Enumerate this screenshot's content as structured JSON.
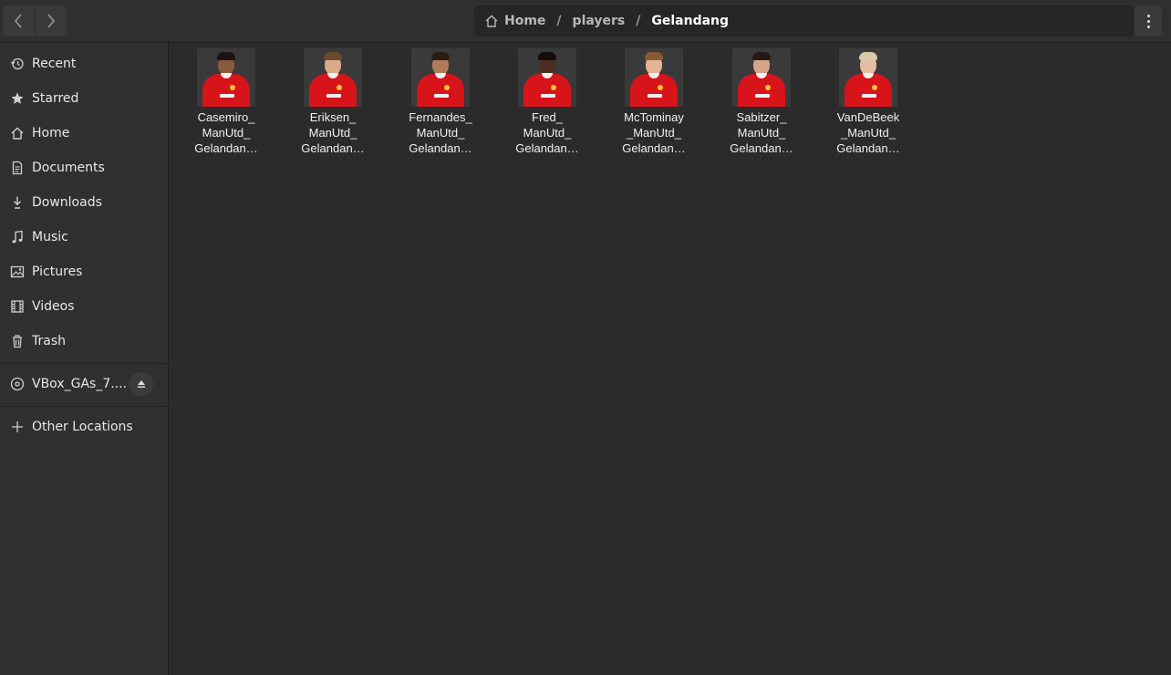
{
  "nav": {
    "back_icon": "chevron-left-icon",
    "forward_icon": "chevron-right-icon"
  },
  "breadcrumb": [
    {
      "label": "Home",
      "icon": "home-icon"
    },
    {
      "label": "players"
    },
    {
      "label": "Gelandang"
    }
  ],
  "sidebar": {
    "items": [
      {
        "label": "Recent",
        "icon": "clock-icon"
      },
      {
        "label": "Starred",
        "icon": "star-icon"
      },
      {
        "label": "Home",
        "icon": "home-icon"
      },
      {
        "label": "Documents",
        "icon": "document-icon"
      },
      {
        "label": "Downloads",
        "icon": "download-icon"
      },
      {
        "label": "Music",
        "icon": "music-icon"
      },
      {
        "label": "Pictures",
        "icon": "picture-icon"
      },
      {
        "label": "Videos",
        "icon": "film-icon"
      },
      {
        "label": "Trash",
        "icon": "trash-icon"
      }
    ],
    "device": {
      "label": "VBox_GAs_7....",
      "icon": "disc-icon",
      "action_icon": "eject-icon"
    },
    "other": {
      "label": "Other Locations",
      "icon": "plus-icon"
    }
  },
  "files": [
    {
      "lines": [
        "Casemiro_",
        "ManUtd_",
        "Gelandan…"
      ],
      "skin": "#8a5a3c",
      "hair": "#1a1412"
    },
    {
      "lines": [
        "Eriksen_",
        "ManUtd_",
        "Gelandan…"
      ],
      "skin": "#d9a98a",
      "hair": "#6b4a2e"
    },
    {
      "lines": [
        "Fernandes_",
        "ManUtd_",
        "Gelandan…"
      ],
      "skin": "#b07a56",
      "hair": "#2a1d16"
    },
    {
      "lines": [
        "Fred_",
        "ManUtd_",
        "Gelandan…"
      ],
      "skin": "#4a2e20",
      "hair": "#120c0a"
    },
    {
      "lines": [
        "McTominay",
        "_ManUtd_",
        "Gelandan…"
      ],
      "skin": "#e3b396",
      "hair": "#8a5a36"
    },
    {
      "lines": [
        "Sabitzer_",
        "ManUtd_",
        "Gelandan…"
      ],
      "skin": "#d6a487",
      "hair": "#241a16"
    },
    {
      "lines": [
        "VanDeBeek",
        "_ManUtd_",
        "Gelandan…"
      ],
      "skin": "#e6bda3",
      "hair": "#d8c9a8"
    }
  ]
}
